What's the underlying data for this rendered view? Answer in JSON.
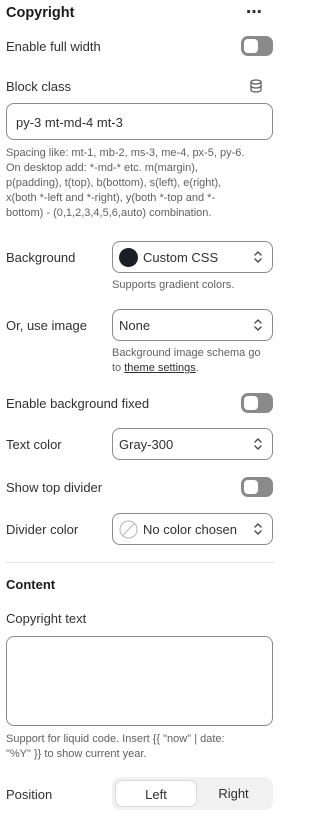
{
  "panel": {
    "title": "Copyright",
    "more_label": "⋯"
  },
  "settings": {
    "full_width_label": "Enable full width",
    "full_width_on": false,
    "block_class_label": "Block class",
    "block_class_value": "py-3 mt-md-4 mt-3",
    "block_class_help": [
      "Spacing like: mt-1, mb-2, ms-3, me-4, px-5, py-6.",
      "On desktop add: *-md-* etc. m(margin),",
      "p(padding), t(top), b(bottom), s(left), e(right),",
      "x(both *-left and *-right), y(both *-top and *-",
      "bottom) - (0,1,2,3,4,5,6,auto) combination."
    ],
    "background_label": "Background",
    "background_value": "Custom CSS",
    "background_swatch_color": "#1a1f26",
    "background_help": "Supports gradient colors.",
    "image_label": "Or, use image",
    "image_value": "None",
    "image_help_line1": "Background image schema go",
    "image_help_prefix": "to ",
    "image_help_link": "theme settings",
    "image_help_suffix": ".",
    "bg_fixed_label": "Enable background fixed",
    "bg_fixed_on": false,
    "text_color_label": "Text color",
    "text_color_value": "Gray-300",
    "top_divider_label": "Show top divider",
    "top_divider_on": false,
    "divider_color_label": "Divider color",
    "divider_color_value": "No color chosen"
  },
  "content": {
    "heading": "Content",
    "copyright_label": "Copyright text",
    "copyright_value": "",
    "copyright_help_line1": "Support for liquid code. Insert {{ \"now\" | date:",
    "copyright_help_line2": "\"%Y\" }} to show current year.",
    "position_label": "Position",
    "position_options": [
      "Left",
      "Right"
    ],
    "position_selected": "Left"
  },
  "colors": {
    "toggle_off": "#8a8a8a",
    "border": "#8a8a8a",
    "divider": "#e3e3e3"
  },
  "icons": {
    "more": "more-horizontal-icon",
    "database": "database-icon",
    "chevron": "select-chevron-icon",
    "no_color": "no-color-swatch-icon"
  }
}
